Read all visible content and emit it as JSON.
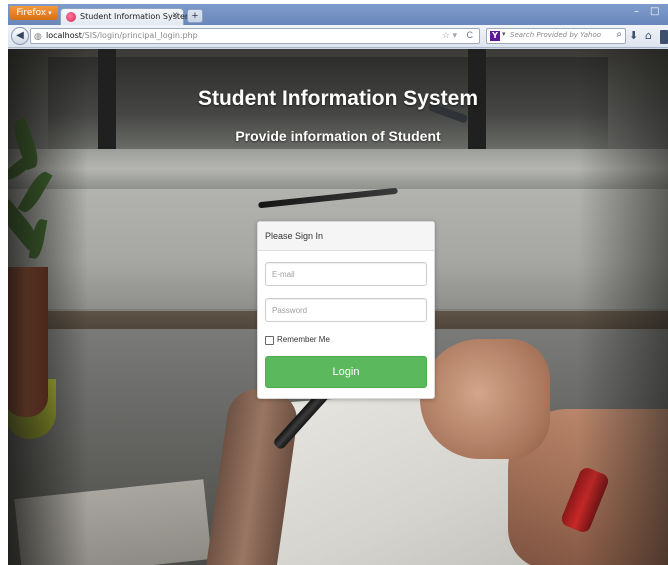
{
  "browser": {
    "menu_button_label": "Firefox",
    "tab": {
      "title": "Student Information System",
      "close_glyph": "×"
    },
    "new_tab_glyph": "+",
    "window_controls": {
      "minimize": "–",
      "maximize": "□"
    },
    "address": {
      "host": "localhost",
      "path": "/SIS/login/principal_login.php"
    },
    "search": {
      "engine_icon": "Y",
      "placeholder": "Search Provided by Yahoo"
    },
    "icons": {
      "back": "back-arrow-icon",
      "site_identity": "globe-icon",
      "bookmark_star": "star-icon",
      "reload": "reload-icon",
      "search_go": "magnifier-icon",
      "downloads": "download-arrow-icon",
      "home": "home-icon"
    }
  },
  "page": {
    "title": "Student Information System",
    "subtitle": "Provide information of Student",
    "login_panel": {
      "heading": "Please Sign In",
      "email_placeholder": "E-mail",
      "email_value": "",
      "password_placeholder": "Password",
      "password_value": "",
      "remember_label": "Remember Me",
      "remember_checked": false,
      "submit_label": "Login"
    }
  },
  "colors": {
    "browser_chrome": "#6a87bb",
    "firefox_button": "#e07a1f",
    "login_button": "#5cb85c",
    "panel_heading_bg": "#f5f5f5"
  }
}
